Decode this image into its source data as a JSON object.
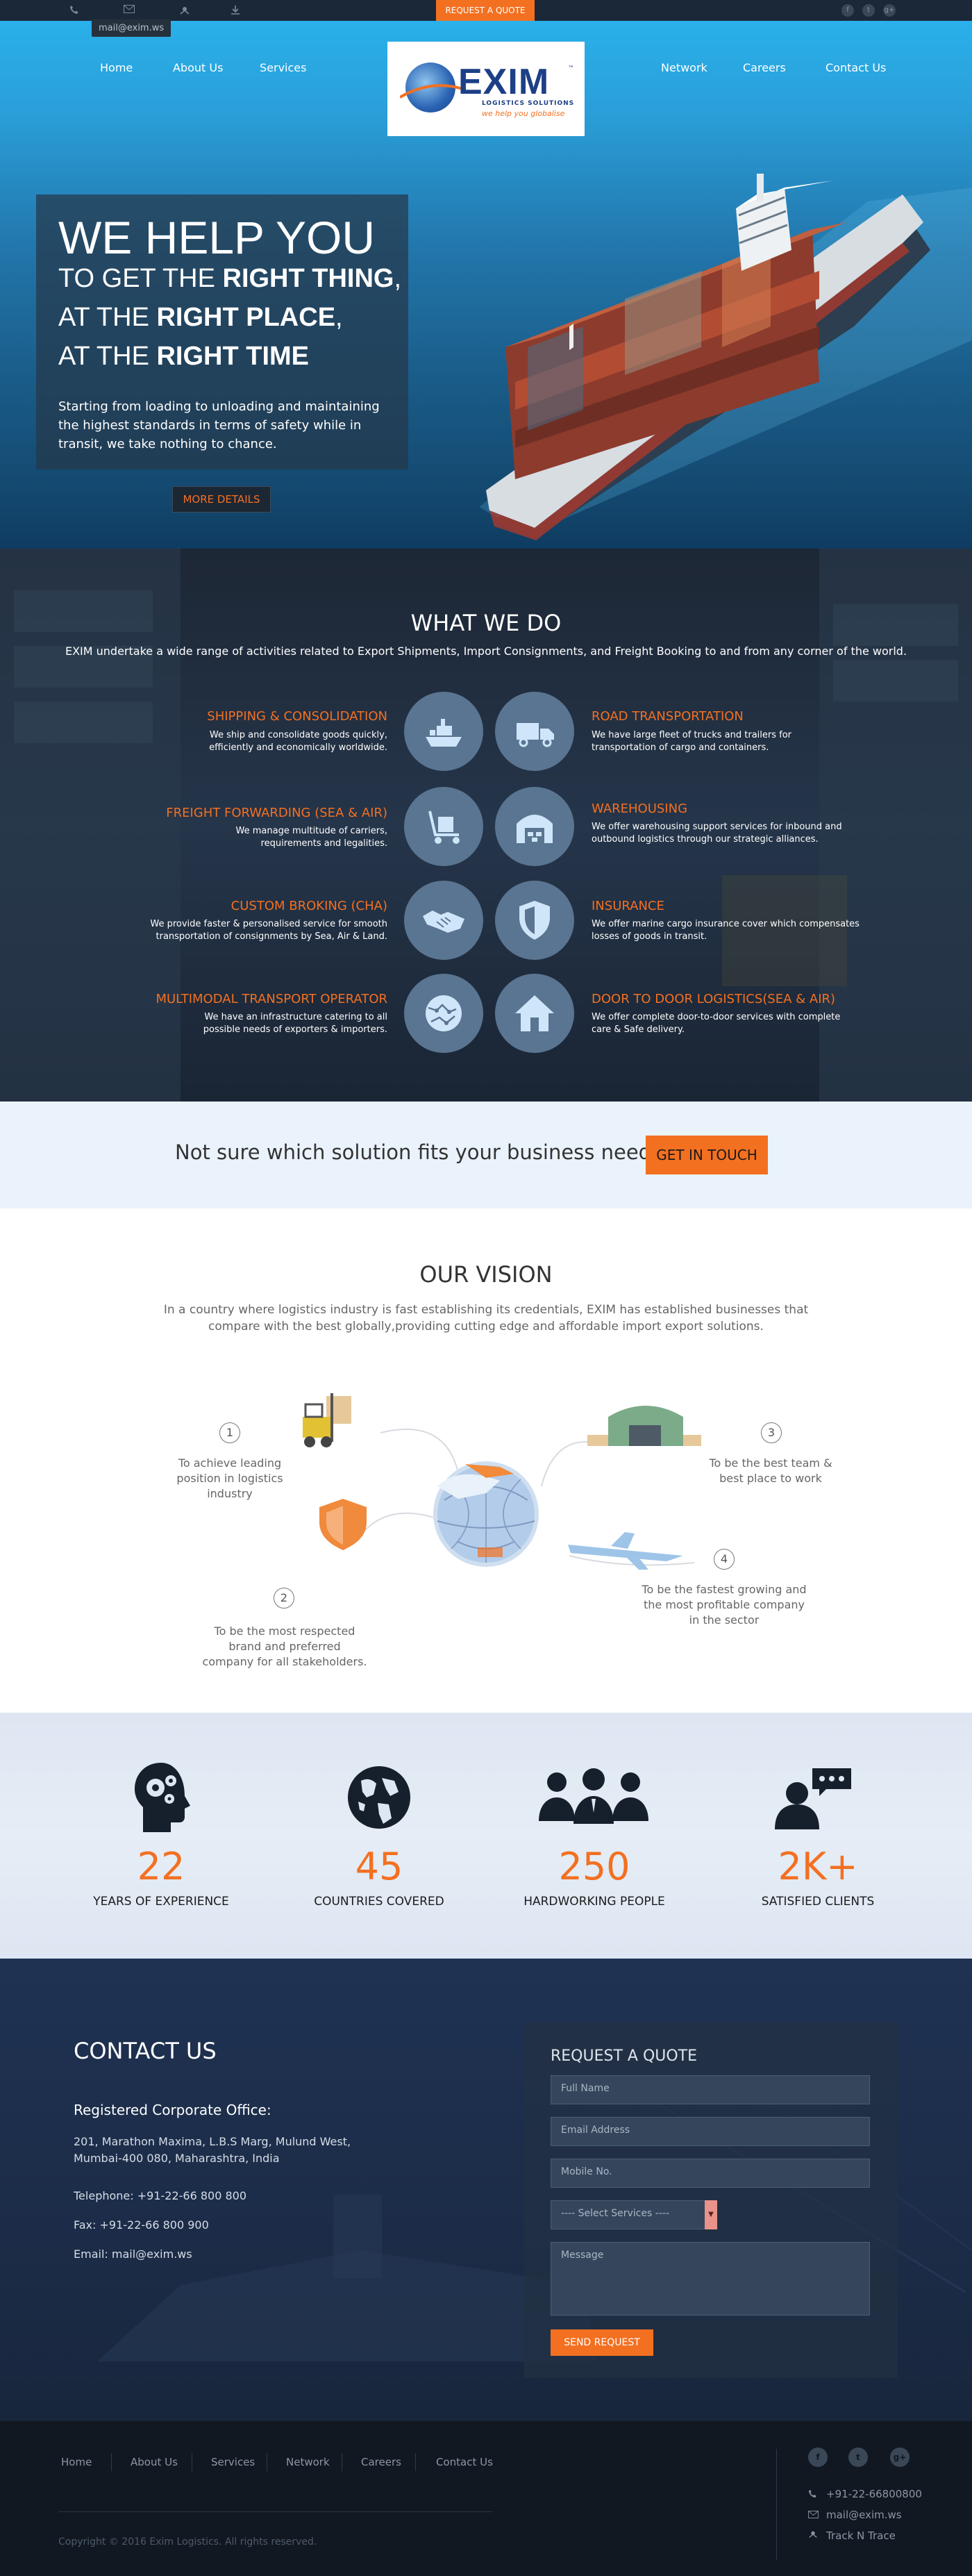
{
  "topbar": {
    "phone_icon": "phone-icon",
    "mail_icon": "mail-icon",
    "track_icon": "truck-icon",
    "download_icon": "download-icon",
    "mail_tooltip": "mail@exim.ws",
    "request_quote": "REQUEST A QUOTE",
    "social": [
      "f",
      "t",
      "g+"
    ]
  },
  "nav": {
    "left": [
      "Home",
      "About Us",
      "Services"
    ],
    "right": [
      "Network",
      "Careers",
      "Contact Us"
    ]
  },
  "logo": {
    "word": "EXIM",
    "sub": "LOGISTICS SOLUTIONS",
    "tagline": "we help you globalise",
    "trademark": "™"
  },
  "hero": {
    "headline": "WE HELP YOU",
    "line1_pre": "TO GET THE ",
    "line1_bold": "RIGHT THING",
    "line1_post": ",",
    "line2_pre": "AT THE ",
    "line2_bold": "RIGHT PLACE",
    "line2_post": ",",
    "line3_pre": "AT THE ",
    "line3_bold": "RIGHT TIME",
    "body": "Starting from loading to unloading and maintaining the highest standards in terms of safety while in transit, we take nothing to chance.",
    "button": "MORE DETAILS"
  },
  "what_we_do": {
    "title": "WHAT WE DO",
    "subtitle": "EXIM undertake a wide range of activities related to Export Shipments, Import Consignments, and Freight Booking to and from any corner of the world.",
    "services": [
      {
        "title": "SHIPPING & CONSOLIDATION",
        "desc1": "We ship and consolidate goods quickly,",
        "desc2": "efficiently and economically  worldwide.",
        "icon": "ship-icon"
      },
      {
        "title": "ROAD TRANSPORTATION",
        "desc1": "We have large fleet of trucks and trailers for",
        "desc2": "transportation of cargo and containers.",
        "icon": "truck-icon"
      },
      {
        "title": "FREIGHT FORWARDING (SEA & AIR)",
        "desc1": "We manage multitude of carriers,",
        "desc2": "requirements and legalities.",
        "icon": "trolley-icon"
      },
      {
        "title": "WAREHOUSING",
        "desc1": "We offer warehousing support services for inbound and",
        "desc2": "outbound logistics through our strategic alliances.",
        "icon": "warehouse-icon"
      },
      {
        "title": "CUSTOM BROKING (CHA)",
        "desc1": "We provide faster & personalised service for smooth",
        "desc2": "transportation of consignments by Sea,  Air & Land.",
        "icon": "handshake-icon"
      },
      {
        "title": "INSURANCE",
        "desc1": "We offer marine cargo insurance cover which compensates",
        "desc2": "losses of goods in transit.",
        "icon": "shield-icon"
      },
      {
        "title": "MULTIMODAL TRANSPORT OPERATOR",
        "desc1": "We have an infrastructure catering to all",
        "desc2": "possible needs of exporters & importers.",
        "icon": "globe-icon"
      },
      {
        "title": "DOOR TO DOOR LOGISTICS(SEA & AIR)",
        "desc1": "We offer complete door-to-door services with complete",
        "desc2": "care & Safe delivery.",
        "icon": "house-icon"
      }
    ]
  },
  "cta": {
    "text": "Not sure which solution fits your business needs?",
    "button": "GET IN TOUCH"
  },
  "vision": {
    "title": "OUR VISION",
    "subtitle": "In a country where logistics industry is fast establishing its credentials, EXIM has established businesses that compare with the best globally,providing cutting edge and affordable import export solutions.",
    "items": [
      {
        "num": "1",
        "l1": "To achieve leading",
        "l2": "position in logistics",
        "l3": "industry"
      },
      {
        "num": "2",
        "l1": "To be the most respected",
        "l2": "brand and preferred",
        "l3": "company for all stakeholders."
      },
      {
        "num": "3",
        "l1": "To be the best team &",
        "l2": "best place to work",
        "l3": ""
      },
      {
        "num": "4",
        "l1": "To be the fastest growing and",
        "l2": "the most profitable company",
        "l3": "in the sector"
      }
    ]
  },
  "stats": [
    {
      "number": "22",
      "label": "YEARS OF EXPERIENCE",
      "icon": "head-gears-icon"
    },
    {
      "number": "45",
      "label": "COUNTRIES COVERED",
      "icon": "world-icon"
    },
    {
      "number": "250",
      "label": "HARDWORKING PEOPLE",
      "icon": "people-icon"
    },
    {
      "number": "2K+",
      "label": "SATISFIED CLIENTS",
      "icon": "client-chat-icon"
    }
  ],
  "contact": {
    "title": "CONTACT US",
    "office": "Registered Corporate Office:",
    "address1": "201, Marathon Maxima, L.B.S Marg, Mulund West,",
    "address2": "Mumbai-400 080, Maharashtra, India",
    "telephone": "Telephone: +91-22-66 800 800",
    "fax": "Fax: +91-22-66 800 900",
    "email": "Email: mail@exim.ws"
  },
  "quote": {
    "title": "REQUEST A QUOTE",
    "full_name": "Full Name",
    "email": "Email Address",
    "mobile": "Mobile No.",
    "select": "---- Select Services ----",
    "message": "Message",
    "send": "SEND REQUEST"
  },
  "footer": {
    "links": [
      "Home",
      "About Us",
      "Services",
      "Network",
      "Careers",
      "Contact Us"
    ],
    "copyright": "Copyright © 2016 Exim Logistics. All rights reserved.",
    "social": [
      "f",
      "t",
      "g+"
    ],
    "phone": "+91-22-66800800",
    "email": "mail@exim.ws",
    "track": "Track N Trace"
  },
  "colors": {
    "accent": "#f37021",
    "hero_sky": "#2ab0ea",
    "dark_navy": "#1b2838",
    "service_circle": "#5a7591",
    "cta_band": "#eaf3fc"
  }
}
